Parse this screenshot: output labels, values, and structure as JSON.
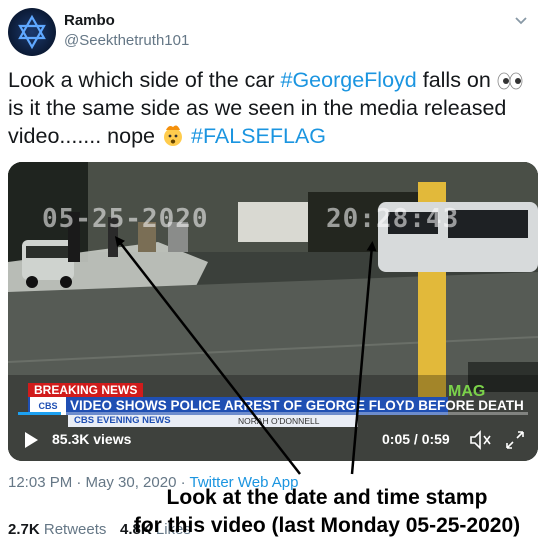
{
  "user": {
    "display_name": "Rambo",
    "handle": "@Seekthetruth101"
  },
  "tweet": {
    "line1_text": "Look a which side of the car ",
    "hashtag1": "#GeorgeFloyd",
    "line1_after": " falls on ",
    "line2_text": "is it the same side as we seen in the media released",
    "line3_text": "video....... nope ",
    "hashtag2": "#FALSEFLAG",
    "emoji1": "eyes-emoji",
    "emoji2": "exploding-head-emoji"
  },
  "video": {
    "burned_date": "05-25-2020",
    "burned_time": "20:28:43",
    "breaking_label": "BREAKING NEWS",
    "headline": "VIDEO SHOWS POLICE ARREST OF GEORGE FLOYD BEFORE DEATH",
    "network_label": "CBS EVENING NEWS",
    "anchor_label": "NORAH O'DONNELL",
    "logo_label": "MAG",
    "views": "85.3K views",
    "time_display": "0:05 / 0:59",
    "progress": 0.085,
    "progress_color": "#1da1f2"
  },
  "meta": {
    "timestamp": "12:03 PM · May 30, 2020 · ",
    "source": "Twitter Web App"
  },
  "stats": {
    "retweets_count": "2.7K",
    "retweets_label": " Retweets",
    "likes_count": "4.8K",
    "likes_label": " Likes"
  },
  "annotation": {
    "line1": "Look at the date and time stamp",
    "line2": "for this video (last Monday 05-25-2020)"
  },
  "colors": {
    "link": "#1b95e0",
    "text": "#14171a",
    "muted": "#657786"
  }
}
